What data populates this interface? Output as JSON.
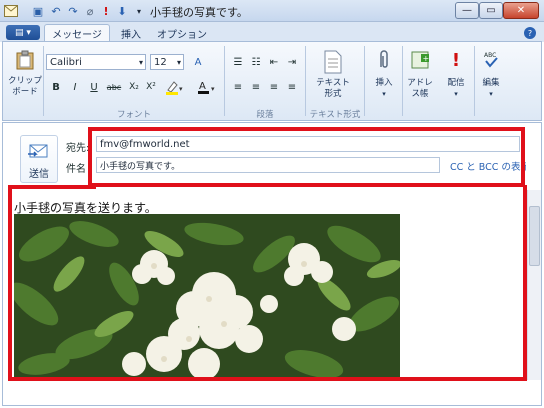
{
  "window": {
    "title": "小手毬の写真です。"
  },
  "tabs": [
    {
      "label": "メッセージ"
    },
    {
      "label": "挿入"
    },
    {
      "label": "オプション"
    }
  ],
  "clipboard": {
    "label1": "クリップ",
    "label2": "ボード"
  },
  "font": {
    "name": "Calibri",
    "size": "12",
    "group_label": "フォント"
  },
  "format": {
    "bold": "B",
    "italic": "I",
    "underline": "U",
    "strike": "abc",
    "sub": "X₂",
    "sup": "X²"
  },
  "paragraph": {
    "group_label": "段落"
  },
  "textformat": {
    "label1": "テキスト",
    "label2": "形式",
    "group_label": "テキスト形式"
  },
  "insert": {
    "label": "挿入"
  },
  "addressbook": {
    "label1": "アドレ",
    "label2": "ス帳"
  },
  "deliver": {
    "label": "配信"
  },
  "editing": {
    "label": "編集"
  },
  "send": {
    "label": "送信"
  },
  "to": {
    "label": "宛先:",
    "value": "fmv@fmworld.net"
  },
  "subject": {
    "label": "件名",
    "value": "小手毬の写真です。"
  },
  "ccbcc": {
    "label": "CC と BCC の表示"
  },
  "body": {
    "text": "小手毬の写真を送ります。"
  },
  "colors": {
    "highlight": "#e0101a",
    "ribbon": "#dde8f5",
    "accent": "#2a62b3"
  }
}
